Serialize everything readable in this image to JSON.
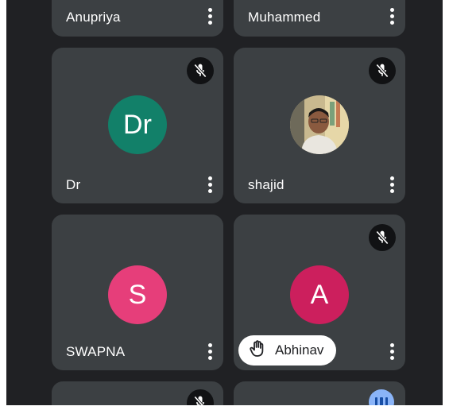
{
  "participants": [
    {
      "name": "Anupriya",
      "avatar": "",
      "muted": false
    },
    {
      "name": "Muhammed",
      "avatar": "",
      "muted": false
    },
    {
      "name": "Dr",
      "avatar": "Dr",
      "avatar_color": "#128069",
      "muted": true
    },
    {
      "name": "shajid",
      "avatar": "photo",
      "muted": true
    },
    {
      "name": "SWAPNA",
      "avatar": "S",
      "avatar_color": "#e63e7a",
      "muted": false
    },
    {
      "name": "Abhinav",
      "avatar": "A",
      "avatar_color": "#cc1f5d",
      "muted": true,
      "hand_raised": true
    },
    {
      "name": "",
      "avatar": "",
      "muted": true
    },
    {
      "name": "",
      "avatar": "",
      "speaking": true
    }
  ],
  "icons": {
    "mute": "mic-off-icon",
    "more": "more-vert-icon",
    "hand": "raised-hand-icon",
    "speaking": "audio-level-icon"
  },
  "colors": {
    "background": "#202124",
    "tile": "#3c4043",
    "speaking_indicator": "#8ab4f8"
  }
}
